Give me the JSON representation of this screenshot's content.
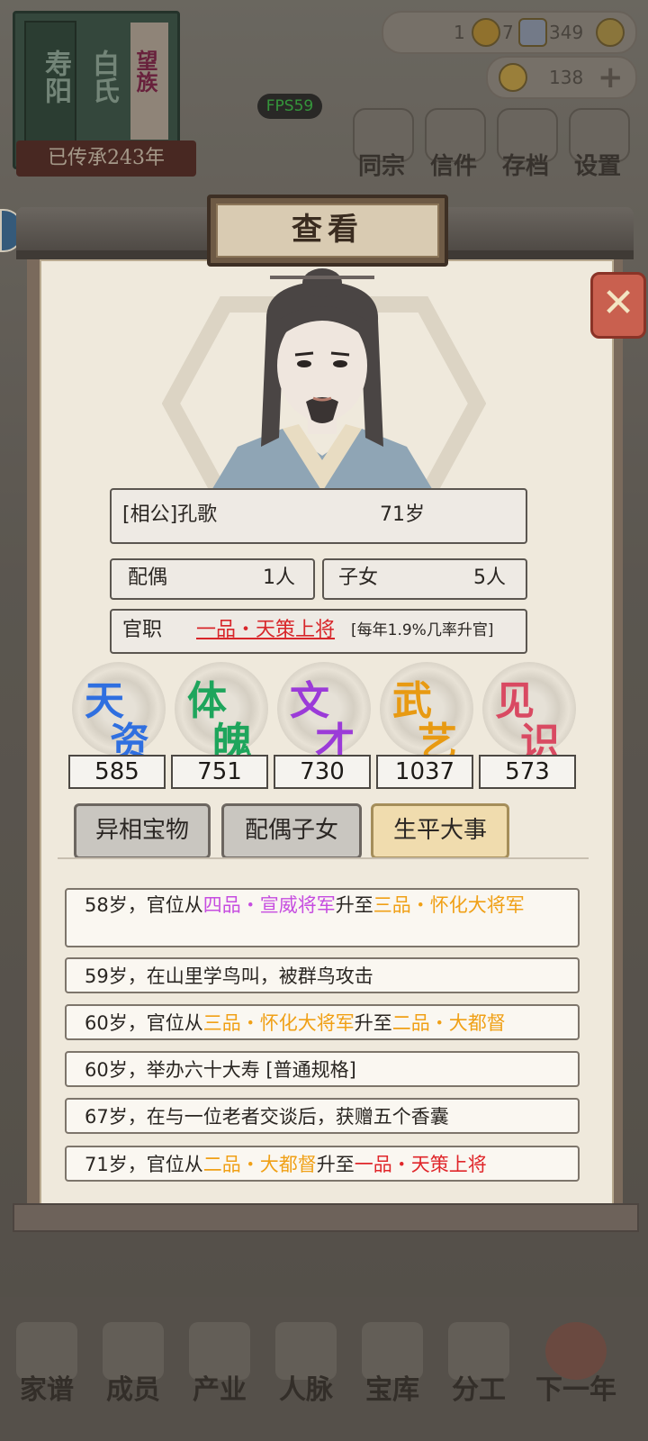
{
  "fps": "FPS59",
  "top": {
    "book_title_a": "寿阳",
    "book_title_b": "白氏",
    "book_tag": "望族",
    "generation": "已传承243年",
    "resources": {
      "a": "1",
      "b": "7",
      "c": "349",
      "d": "138"
    },
    "nav": [
      "同宗",
      "信件",
      "存档",
      "设置"
    ]
  },
  "dialog": {
    "title": "查看",
    "profile": {
      "name": "[相公]孔歌",
      "age": "71岁"
    },
    "spouse": {
      "label": "配偶",
      "value": "1人"
    },
    "children": {
      "label": "子女",
      "value": "5人"
    },
    "office": {
      "label": "官职",
      "value": "一品・天策上将",
      "note": "[每年1.9%几率升官]"
    },
    "stats": [
      {
        "label": "天资",
        "value": "585",
        "color": "#2f6fe0"
      },
      {
        "label": "体魄",
        "value": "751",
        "color": "#1ea55c"
      },
      {
        "label": "文才",
        "value": "730",
        "color": "#9b3bd8"
      },
      {
        "label": "武艺",
        "value": "1037",
        "color": "#e89a12"
      },
      {
        "label": "见识",
        "value": "573",
        "color": "#d94a62"
      }
    ],
    "tabs": [
      "异相宝物",
      "配偶子女",
      "生平大事"
    ],
    "events": [
      {
        "pre": "58岁，官位从",
        "from": "四品・宣威将军",
        "mid": "升至",
        "to": "三品・怀化大将军"
      },
      {
        "text": "59岁，在山里学鸟叫，被群鸟攻击"
      },
      {
        "pre": "60岁，官位从",
        "from": "三品・怀化大将军",
        "mid": "升至",
        "to": "二品・大都督"
      },
      {
        "text": "60岁，举办六十大寿 [普通规格]"
      },
      {
        "text": "67岁，在与一位老者交谈后，获赠五个香囊"
      },
      {
        "pre": "71岁，官位从",
        "from": "二品・大都督",
        "mid": "升至",
        "to": "一品・天策上将"
      }
    ]
  },
  "bottom_nav": [
    "家谱",
    "成员",
    "产业",
    "人脉",
    "宝库",
    "分工",
    "下一年"
  ],
  "colors": {
    "paper": "#efe9dc",
    "event_purple": "#c64de0",
    "event_orange": "#f0a016",
    "event_red": "#e0262a"
  }
}
